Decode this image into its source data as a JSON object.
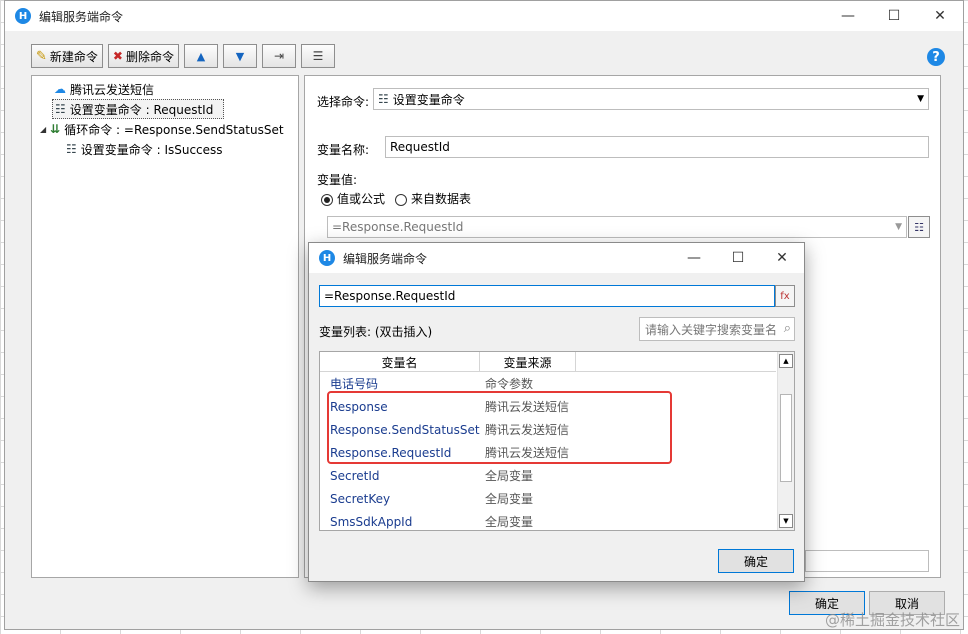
{
  "window": {
    "title": "编辑服务端命令",
    "minimize": "—",
    "maximize": "☐",
    "close": "✕"
  },
  "toolbar": {
    "new_command": "新建命令",
    "delete_command": "删除命令"
  },
  "tree": {
    "items": [
      {
        "label": "腾讯云发送短信"
      },
      {
        "label": "设置变量命令 : RequestId"
      },
      {
        "label": "循环命令 : =Response.SendStatusSet"
      },
      {
        "label": "设置变量命令 : IsSuccess"
      }
    ]
  },
  "props": {
    "select_command_label": "选择命令:",
    "select_command_value": "设置变量命令",
    "var_name_label": "变量名称:",
    "var_name_value": "RequestId",
    "var_value_label": "变量值:",
    "radio_formula": "值或公式",
    "radio_table": "来自数据表",
    "formula_value": "=Response.RequestId"
  },
  "footer": {
    "ok": "确定",
    "cancel": "取消"
  },
  "dialog": {
    "title": "编辑服务端命令",
    "formula_value": "=Response.RequestId",
    "var_list_label": "变量列表: (双击插入)",
    "search_placeholder": "请输入关键字搜索变量名",
    "col_name": "变量名",
    "col_source": "变量来源",
    "rows": [
      {
        "name": "电话号码",
        "source": "命令参数"
      },
      {
        "name": "Response",
        "source": "腾讯云发送短信"
      },
      {
        "name": "Response.SendStatusSet",
        "source": "腾讯云发送短信"
      },
      {
        "name": "Response.RequestId",
        "source": "腾讯云发送短信"
      },
      {
        "name": "SecretId",
        "source": "全局变量"
      },
      {
        "name": "SecretKey",
        "source": "全局变量"
      },
      {
        "name": "SmsSdkAppId",
        "source": "全局变量"
      }
    ],
    "ok": "确定"
  },
  "watermark": "@稀土掘金技术社区",
  "colors": {
    "accent": "#0078d7",
    "highlight": "#e53935",
    "icon_blue": "#1e88e5"
  }
}
